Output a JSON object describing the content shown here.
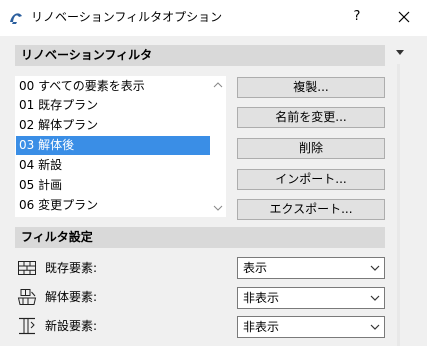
{
  "window": {
    "title": "リノベーションフィルタオプション",
    "help_label": "?"
  },
  "renovation_filters": {
    "header": "リノベーションフィルタ",
    "items": [
      {
        "label": "00 すべての要素を表示",
        "selected": false
      },
      {
        "label": "01 既存プラン",
        "selected": false
      },
      {
        "label": "02 解体プラン",
        "selected": false
      },
      {
        "label": "03 解体後",
        "selected": true
      },
      {
        "label": "04 新設",
        "selected": false
      },
      {
        "label": "05 計画",
        "selected": false
      },
      {
        "label": "06 変更プラン",
        "selected": false
      }
    ],
    "buttons": {
      "duplicate": "複製...",
      "rename": "名前を変更...",
      "delete": "削除",
      "import": "インポート...",
      "export": "エクスポート..."
    }
  },
  "filter_settings": {
    "header": "フィルタ設定",
    "rows": [
      {
        "label": "既存要素:",
        "value": "表示",
        "icon": "existing-elements-icon"
      },
      {
        "label": "解体要素:",
        "value": "非表示",
        "icon": "demolished-elements-icon"
      },
      {
        "label": "新設要素:",
        "value": "非表示",
        "icon": "new-elements-icon"
      }
    ]
  },
  "colors": {
    "selection": "#3a8ee6",
    "section_header_bg": "#d9d9d9",
    "window_bg": "#f0f0f0"
  }
}
